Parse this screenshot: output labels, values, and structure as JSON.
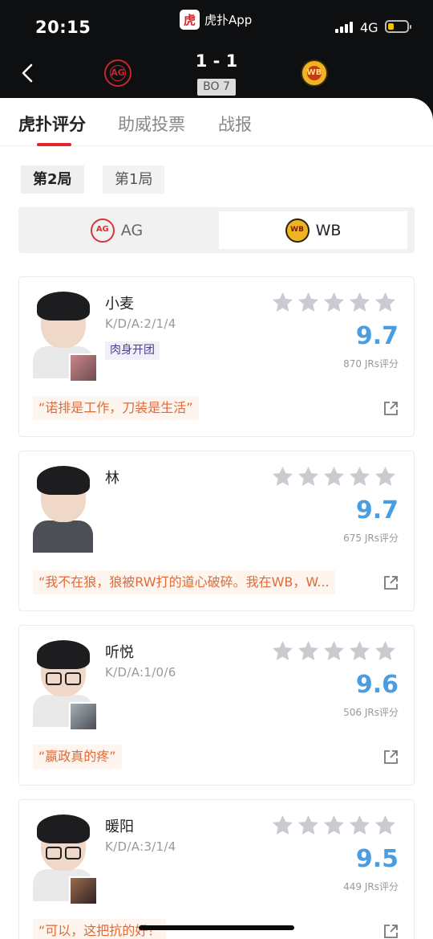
{
  "status_bar": {
    "time": "20:15",
    "app_name": "虎扑App",
    "app_logo_char": "虎",
    "network": "4G"
  },
  "match": {
    "score": "1 - 1",
    "format": "BO 7",
    "team_left": "AG",
    "team_right": "WB"
  },
  "tabs": [
    {
      "label": "虎扑评分",
      "active": true
    },
    {
      "label": "助威投票"
    },
    {
      "label": "战报"
    }
  ],
  "games": [
    {
      "label": "第2局",
      "selected": true
    },
    {
      "label": "第1局"
    }
  ],
  "team_switch": [
    {
      "label": "AG"
    },
    {
      "label": "WB",
      "selected": true
    }
  ],
  "players": [
    {
      "name": "小麦",
      "kda": "K/D/A:2/1/4",
      "tag": "肉身开团",
      "rating": "9.7",
      "count": "870 JRs评分",
      "comment": "“诺排是工作，刀装是生活”"
    },
    {
      "name": "林",
      "kda": "",
      "tag": "",
      "rating": "9.7",
      "count": "675 JRs评分",
      "comment": "“我不在狼，狼被RW打的道心破碎。我在WB，W..."
    },
    {
      "name": "听悦",
      "kda": "K/D/A:1/0/6",
      "tag": "",
      "rating": "9.6",
      "count": "506 JRs评分",
      "comment": "“嬴政真的疼”"
    },
    {
      "name": "暖阳",
      "kda": "K/D/A:3/1/4",
      "tag": "",
      "rating": "9.5",
      "count": "449 JRs评分",
      "comment": "“可以，这把抗的好！"
    }
  ],
  "colors": {
    "accent_red": "#e0262a",
    "rating_blue": "#4a9de0",
    "comment_orange": "#e06a3a"
  }
}
